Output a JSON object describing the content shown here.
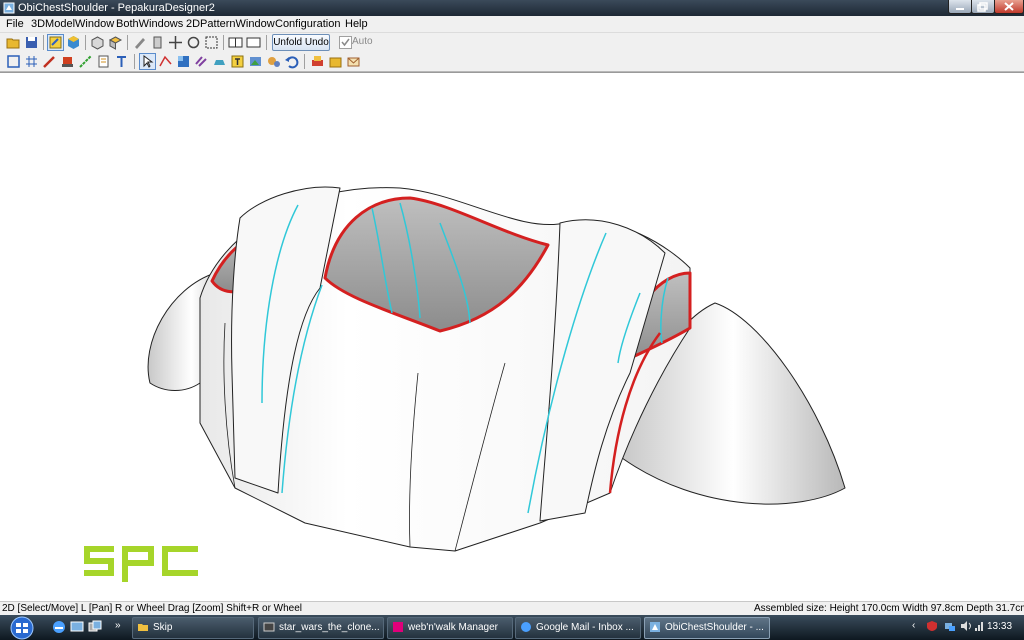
{
  "window": {
    "title": "ObiChestShoulder - PepakuraDesigner2"
  },
  "menu": [
    "File",
    "3DModelWindow",
    "BothWindows",
    "2DPatternWindow",
    "Configuration",
    "Help"
  ],
  "toolbar": {
    "row1_icons": [
      "open-file-icon",
      "save-icon",
      "toggle-2d-icon",
      "view-3d-icon",
      "paper-box-icon",
      "unfold-box-icon",
      "pencil-icon",
      "edge-icon",
      "move-parts-icon",
      "select-faces-icon",
      "window-left-icon",
      "window-right-icon"
    ],
    "unfold_undo_label": "Unfold Undo",
    "auto_label": "Auto",
    "auto_checked": true,
    "row2_icons": [
      "zoom-fit-icon",
      "grid-icon",
      "brush-icon",
      "stamp-icon",
      "join-icon",
      "page-settings-icon",
      "text-icon",
      "select-arrow-icon",
      "cut-edge-icon",
      "texture-icon",
      "fold-lines-icon",
      "flap-icon",
      "text-label-icon",
      "image-icon",
      "measure-icon",
      "undo-icon",
      "print-icon",
      "layout-icon",
      "envelope-icon"
    ]
  },
  "viewport": {
    "model_name": "ObiChestShoulder 3D model",
    "watermark": "spc",
    "watermark_color": "#a6d52a",
    "seam_color": "#d42020",
    "fold_color": "#30c8d8"
  },
  "status": {
    "left": "2D [Select/Move] L [Pan] R or Wheel Drag [Zoom] Shift+R or Wheel",
    "right": "Assembled size: Height 170.0cm Width 97.8cm Depth 31.7cm"
  },
  "taskbar": {
    "items": [
      {
        "label": "Skip"
      },
      {
        "label": "star_wars_the_clone..."
      },
      {
        "label": "web'n'walk Manager"
      },
      {
        "label": "Google Mail - Inbox ..."
      },
      {
        "label": "ObiChestShoulder - ..."
      }
    ],
    "clock": "13:33"
  }
}
